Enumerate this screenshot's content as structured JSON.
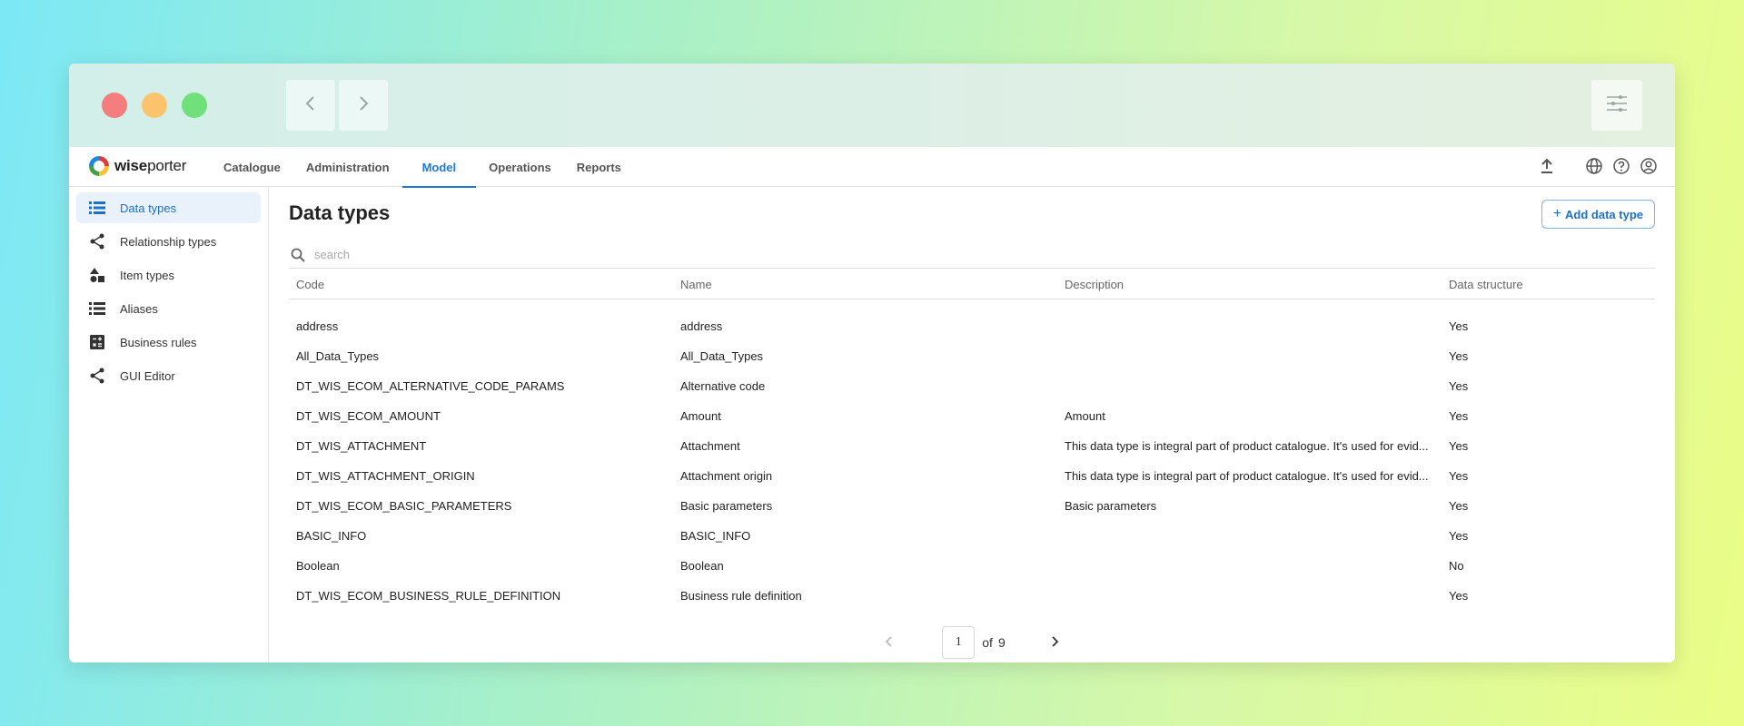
{
  "app": {
    "logo_text_bold": "wise",
    "logo_text_rest": "porter"
  },
  "tabs": [
    {
      "label": "Catalogue"
    },
    {
      "label": "Administration"
    },
    {
      "label": "Model"
    },
    {
      "label": "Operations"
    },
    {
      "label": "Reports"
    }
  ],
  "sidebar": {
    "items": [
      {
        "label": "Data types",
        "icon": "list-icon"
      },
      {
        "label": "Relationship types",
        "icon": "share-icon"
      },
      {
        "label": "Item types",
        "icon": "shapes-icon"
      },
      {
        "label": "Aliases",
        "icon": "list-icon"
      },
      {
        "label": "Business rules",
        "icon": "calculate-icon"
      },
      {
        "label": "GUI Editor",
        "icon": "share-icon"
      }
    ]
  },
  "main": {
    "title": "Data types",
    "add_button_label": "Add data type",
    "search_placeholder": "search"
  },
  "table": {
    "headers": {
      "code": "Code",
      "name": "Name",
      "description": "Description",
      "structure": "Data structure"
    },
    "rows": [
      {
        "code": "address",
        "name": "address",
        "description": "",
        "structure": "Yes"
      },
      {
        "code": "All_Data_Types",
        "name": "All_Data_Types",
        "description": "",
        "structure": "Yes"
      },
      {
        "code": "DT_WIS_ECOM_ALTERNATIVE_CODE_PARAMS",
        "name": "Alternative code",
        "description": "",
        "structure": "Yes"
      },
      {
        "code": "DT_WIS_ECOM_AMOUNT",
        "name": "Amount",
        "description": "Amount",
        "structure": "Yes"
      },
      {
        "code": "DT_WIS_ATTACHMENT",
        "name": "Attachment",
        "description": "This data type is integral part of product catalogue. It's used for evid...",
        "structure": "Yes"
      },
      {
        "code": "DT_WIS_ATTACHMENT_ORIGIN",
        "name": "Attachment origin",
        "description": "This data type is integral part of product catalogue. It's used for evid...",
        "structure": "Yes"
      },
      {
        "code": "DT_WIS_ECOM_BASIC_PARAMETERS",
        "name": "Basic parameters",
        "description": "Basic parameters",
        "structure": "Yes"
      },
      {
        "code": "BASIC_INFO",
        "name": "BASIC_INFO",
        "description": "",
        "structure": "Yes"
      },
      {
        "code": "Boolean",
        "name": "Boolean",
        "description": "",
        "structure": "No"
      },
      {
        "code": "DT_WIS_ECOM_BUSINESS_RULE_DEFINITION",
        "name": "Business rule definition",
        "description": "",
        "structure": "Yes"
      }
    ]
  },
  "pagination": {
    "current": "1",
    "of_label": "of",
    "total": "9"
  },
  "colors": {
    "accent": "#1e7ad6",
    "active_bg": "#e9f1fb"
  }
}
